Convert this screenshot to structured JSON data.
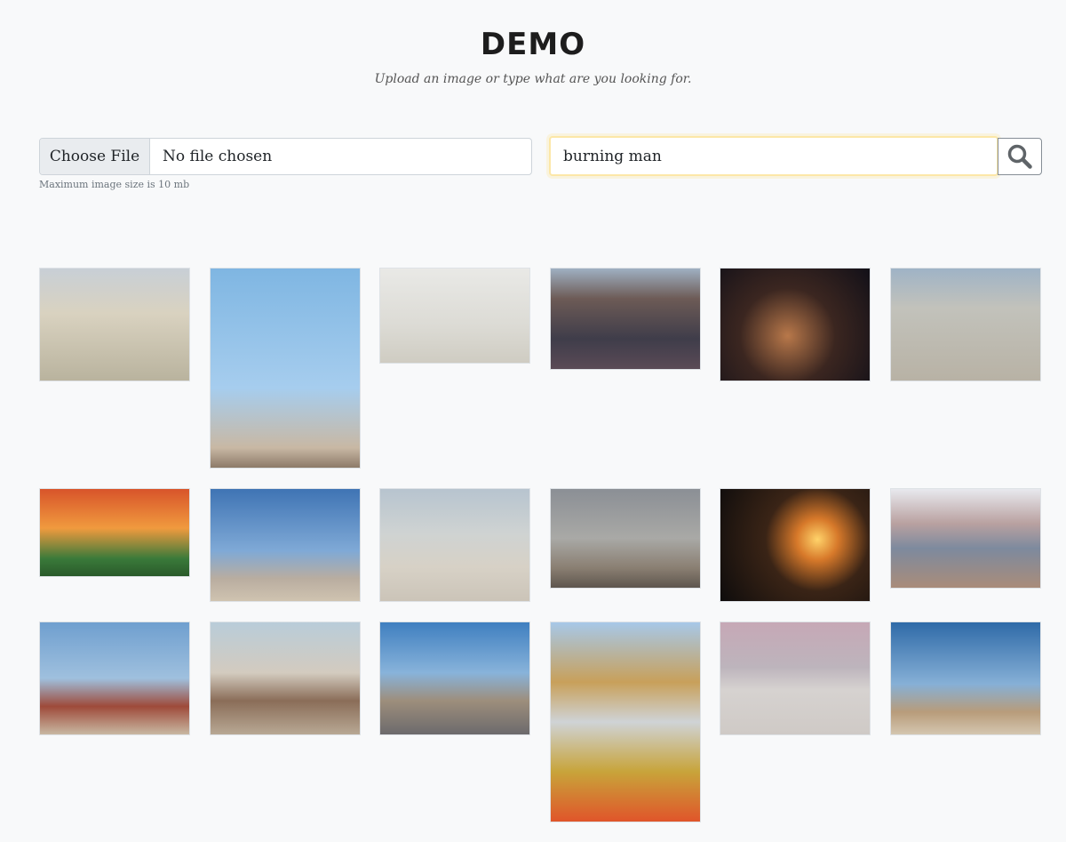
{
  "header": {
    "title": "DEMO",
    "subtitle": "Upload an image or type what are you looking for."
  },
  "upload": {
    "button_label": "Choose File",
    "file_status": "No file chosen",
    "hint": "Maximum image size is 10 mb"
  },
  "search": {
    "value": "burning man",
    "button_icon": "search-icon"
  },
  "results": [
    {
      "name": "result-image-1",
      "bg": "linear-gradient(180deg,#c8cfd6 0%,#d9d2c0 40%,#b9b39e 100%)"
    },
    {
      "name": "result-image-2",
      "bg": "linear-gradient(180deg,#7fb6e2 0%,#a6cdee 60%,#c8b8a4 90%,#8d7a68 100%)"
    },
    {
      "name": "result-image-3",
      "bg": "linear-gradient(180deg,#e9e9e6 0%,#dcdbd5 60%,#cfccc2 100%)"
    },
    {
      "name": "result-image-4",
      "bg": "linear-gradient(180deg,#9fb0c2 0%,#6d5b56 30%,#3f3d4a 70%,#5a4a56 100%)"
    },
    {
      "name": "result-image-5",
      "bg": "radial-gradient(circle at 45% 60%,#b8784a 0%,#3b2620 45%,#121018 100%)"
    },
    {
      "name": "result-image-6",
      "bg": "linear-gradient(180deg,#9fb3c6 0%,#c2c2bb 35%,#b8b2a5 100%)"
    },
    {
      "name": "result-image-7",
      "bg": "linear-gradient(180deg,#d8542a 0%,#f09a3e 45%,#3a7a3a 80%,#2a5a2a 100%)"
    },
    {
      "name": "result-image-8",
      "bg": "linear-gradient(180deg,#3f74b4 0%,#7fa9d6 55%,#b9ada0 80%,#cfc3b0 100%)"
    },
    {
      "name": "result-image-9",
      "bg": "linear-gradient(180deg,#b7c4cf 0%,#cfd3d2 40%,#d7d1c6 70%,#cbc4b8 100%)"
    },
    {
      "name": "result-image-10",
      "bg": "linear-gradient(180deg,#8b8f95 0%,#a9a9a6 50%,#8a7f72 80%,#5e564e 100%)"
    },
    {
      "name": "result-image-11",
      "bg": "radial-gradient(circle at 65% 45%,#ffd36a 0%,#d7792a 18%,#3a2416 45%,#0e0c0c 100%)"
    },
    {
      "name": "result-image-12",
      "bg": "linear-gradient(180deg,#e8e9ee 0%,#b9a1a0 35%,#7d8a9e 60%,#a98c7a 100%)"
    },
    {
      "name": "result-image-13",
      "bg": "linear-gradient(180deg,#6f9fcf 0%,#9fc0de 50%,#9e4a3a 75%,#c8b8a2 100%)"
    },
    {
      "name": "result-image-14",
      "bg": "linear-gradient(180deg,#b9ccd9 0%,#d3cbbf 45%,#8a6d58 70%,#b8a894 100%)"
    },
    {
      "name": "result-image-15",
      "bg": "linear-gradient(180deg,#3f7fc0 0%,#88b3da 45%,#9d8e7c 70%,#6c6a6c 100%)"
    },
    {
      "name": "result-image-16",
      "bg": "linear-gradient(180deg,#a7c8e8 0%,#c8a05a 30%,#cfd3d6 50%,#c8a43a 75%,#e0552a 100%)"
    },
    {
      "name": "result-image-17",
      "bg": "linear-gradient(180deg,#c6a8b6 0%,#bdb4bc 40%,#d6d2d0 60%,#cfcac6 100%)"
    },
    {
      "name": "result-image-18",
      "bg": "linear-gradient(180deg,#2f6aa8 0%,#86b0d6 55%,#b89c7a 80%,#d4c6b0 100%)"
    }
  ]
}
